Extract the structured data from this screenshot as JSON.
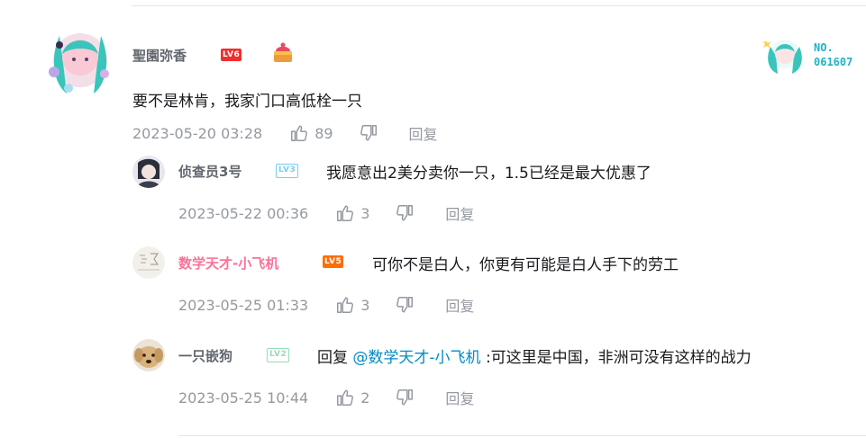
{
  "main_comment": {
    "username": "聖園弥香",
    "level": "LV6",
    "content": "要不是林肯，我家门口高低栓一只",
    "time": "2023-05-20 03:28",
    "likes": "89",
    "reply_label": "回复",
    "fan_badge": {
      "line1": "NO.",
      "line2": "061607"
    }
  },
  "replies": [
    {
      "username": "侦查员3号",
      "level": "LV3",
      "content": "我愿意出2美分卖你一只，1.5已经是最大优惠了",
      "time": "2023-05-22 00:36",
      "likes": "3",
      "reply_label": "回复"
    },
    {
      "username": "数学天才-小飞机",
      "level": "LV5",
      "content": "可你不是白人，你更有可能是白人手下的劳工",
      "time": "2023-05-25 01:33",
      "likes": "3",
      "reply_label": "回复"
    },
    {
      "username": "一只嵌狗",
      "level": "LV2",
      "content_prefix": "回复 ",
      "mention": "@数学天才-小飞机",
      "content": " :可这里是中国，非洲可没有这样的战力",
      "time": "2023-05-25 10:44",
      "likes": "2",
      "reply_label": "回复"
    }
  ],
  "colors": {
    "accent": "#008ac5",
    "pink_name": "#fb7299",
    "meta": "#9499a0"
  }
}
